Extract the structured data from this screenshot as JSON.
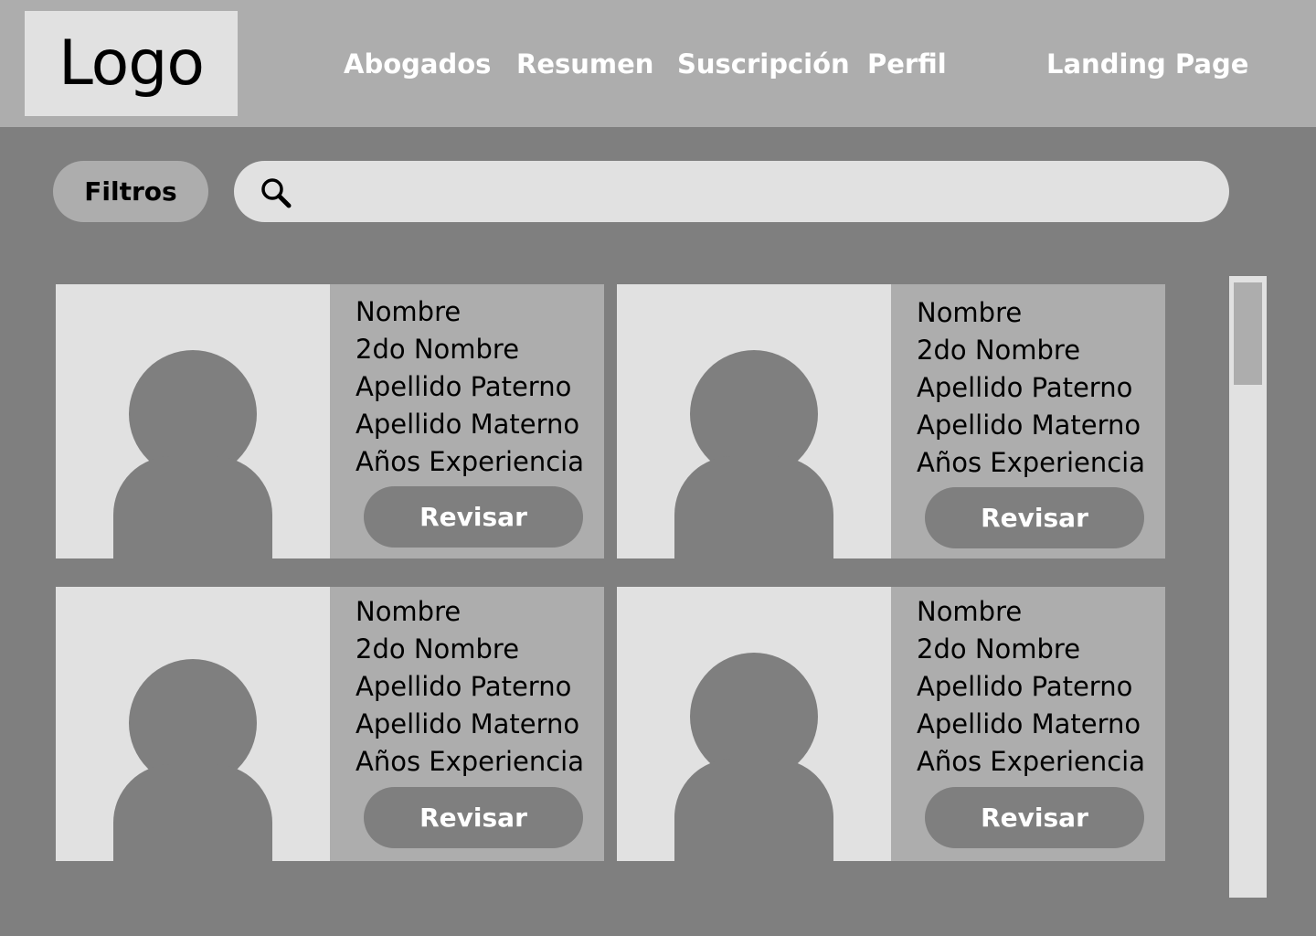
{
  "header": {
    "logo": "Logo",
    "nav": {
      "abogados": "Abogados",
      "resumen": "Resumen",
      "suscripcion": "Suscripción",
      "perfil": "Perfil",
      "landing": "Landing Page"
    }
  },
  "toolbar": {
    "filters_label": "Filtros",
    "search_placeholder": "",
    "search_value": ""
  },
  "cards": [
    {
      "nombre": "Nombre",
      "segundo_nombre": "2do Nombre",
      "apellido_paterno": "Apellido Paterno",
      "apellido_materno": "Apellido Materno",
      "experiencia": "Años Experiencia",
      "button": "Revisar"
    },
    {
      "nombre": "Nombre",
      "segundo_nombre": "2do Nombre",
      "apellido_paterno": "Apellido Paterno",
      "apellido_materno": "Apellido Materno",
      "experiencia": "Años Experiencia",
      "button": "Revisar"
    },
    {
      "nombre": "Nombre",
      "segundo_nombre": "2do Nombre",
      "apellido_paterno": "Apellido Paterno",
      "apellido_materno": "Apellido Materno",
      "experiencia": "Años Experiencia",
      "button": "Revisar"
    },
    {
      "nombre": "Nombre",
      "segundo_nombre": "2do Nombre",
      "apellido_paterno": "Apellido Paterno",
      "apellido_materno": "Apellido Materno",
      "experiencia": "Años Experiencia",
      "button": "Revisar"
    }
  ],
  "icons": {
    "search": "search-icon",
    "avatar": "person-placeholder-icon"
  },
  "colors": {
    "background": "#7f7f7f",
    "header": "#adadad",
    "light": "#e1e1e1",
    "text_light": "#ffffff",
    "text_dark": "#000000"
  }
}
